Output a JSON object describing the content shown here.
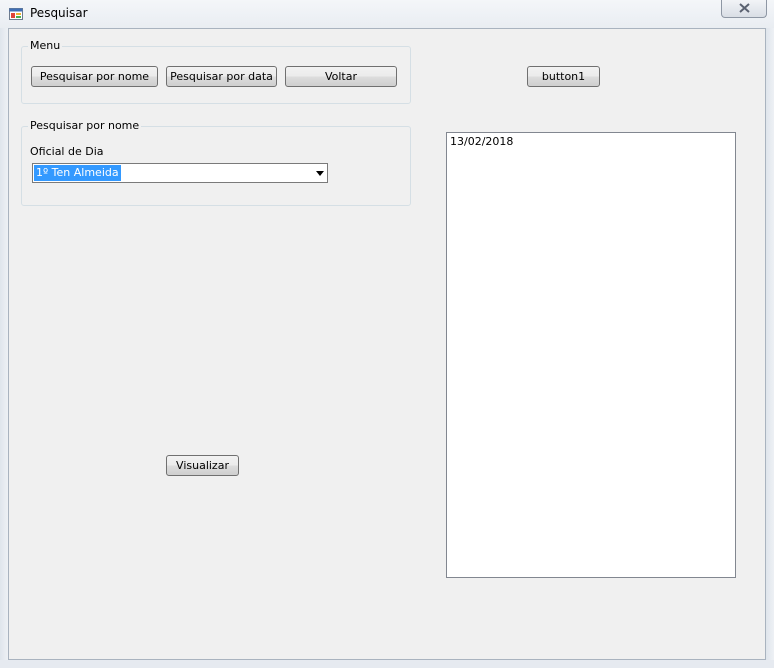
{
  "window": {
    "title": "Pesquisar"
  },
  "menu_group": {
    "label": "Menu",
    "buttons": {
      "search_by_name": "Pesquisar por nome",
      "search_by_date": "Pesquisar por data",
      "back": "Voltar"
    }
  },
  "button1": {
    "label": "button1"
  },
  "search_group": {
    "label": "Pesquisar por nome",
    "officer_label": "Oficial de Dia",
    "officer_selected": "1º Ten Almeida"
  },
  "visualize_button": {
    "label": "Visualizar"
  },
  "results_list": {
    "items": [
      "13/02/2018"
    ]
  },
  "colors": {
    "selection": "#3399ff",
    "window_bg": "#f0f0f0"
  },
  "icons": {
    "app": "window-app-icon",
    "close": "close-icon",
    "dropdown": "chevron-down-icon"
  }
}
